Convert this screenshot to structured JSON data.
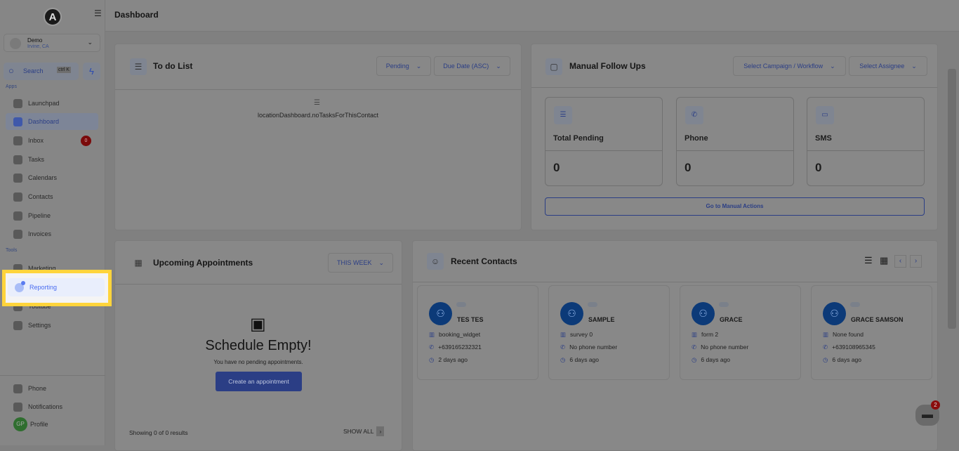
{
  "header": {
    "title": "Dashboard"
  },
  "sidebar": {
    "logo": "A",
    "location": {
      "name": "Demo",
      "city": "Irvine, CA"
    },
    "search": {
      "label": "Search",
      "shortcut": "ctrl K"
    },
    "apps_label": "Apps",
    "tools_label": "Tools",
    "apps": [
      {
        "label": "Launchpad"
      },
      {
        "label": "Dashboard",
        "active": true
      },
      {
        "label": "Inbox",
        "badge": "0"
      },
      {
        "label": "Tasks"
      },
      {
        "label": "Calendars"
      },
      {
        "label": "Contacts"
      },
      {
        "label": "Pipeline"
      },
      {
        "label": "Invoices"
      }
    ],
    "tools": [
      {
        "label": "Marketing"
      },
      {
        "label": "Reporting"
      },
      {
        "label": "Youtube"
      },
      {
        "label": "Settings"
      }
    ],
    "bottom": [
      {
        "label": "Phone"
      },
      {
        "label": "Notifications"
      },
      {
        "label": "Profile",
        "initials": "GP"
      }
    ]
  },
  "todo": {
    "title": "To do List",
    "filter": "Pending",
    "sort": "Due Date (ASC)",
    "empty": "locationDashboard.noTasksForThisContact"
  },
  "followups": {
    "title": "Manual Follow Ups",
    "campaign": "Select Campaign / Workflow",
    "assignee": "Select Assignee",
    "stats": [
      {
        "label": "Total Pending",
        "value": "0"
      },
      {
        "label": "Phone",
        "value": "0"
      },
      {
        "label": "SMS",
        "value": "0"
      }
    ],
    "action": "Go to Manual Actions"
  },
  "appointments": {
    "title": "Upcoming Appointments",
    "range": "THIS WEEK",
    "empty_title": "Schedule Empty!",
    "empty_sub": "You have no pending appointments.",
    "create": "Create an appointment",
    "showing": "Showing 0 of 0 results",
    "show_all": "SHOW ALL"
  },
  "contacts": {
    "title": "Recent Contacts",
    "items": [
      {
        "name": "TES TES",
        "source": "booking_widget",
        "phone": "+639165232321",
        "time": "2 days ago"
      },
      {
        "name": "SAMPLE",
        "source": "survey 0",
        "phone": "No phone number",
        "time": "6 days ago"
      },
      {
        "name": "GRACE",
        "source": "form 2",
        "phone": "No phone number",
        "time": "6 days ago"
      },
      {
        "name": "GRACE SAMSON",
        "source": "None found",
        "phone": "+639108965345",
        "time": "6 days ago"
      }
    ]
  },
  "chat": {
    "badge": "2"
  },
  "colors": {
    "highlight": "#ffd43b",
    "accent": "#4a6cf0"
  }
}
